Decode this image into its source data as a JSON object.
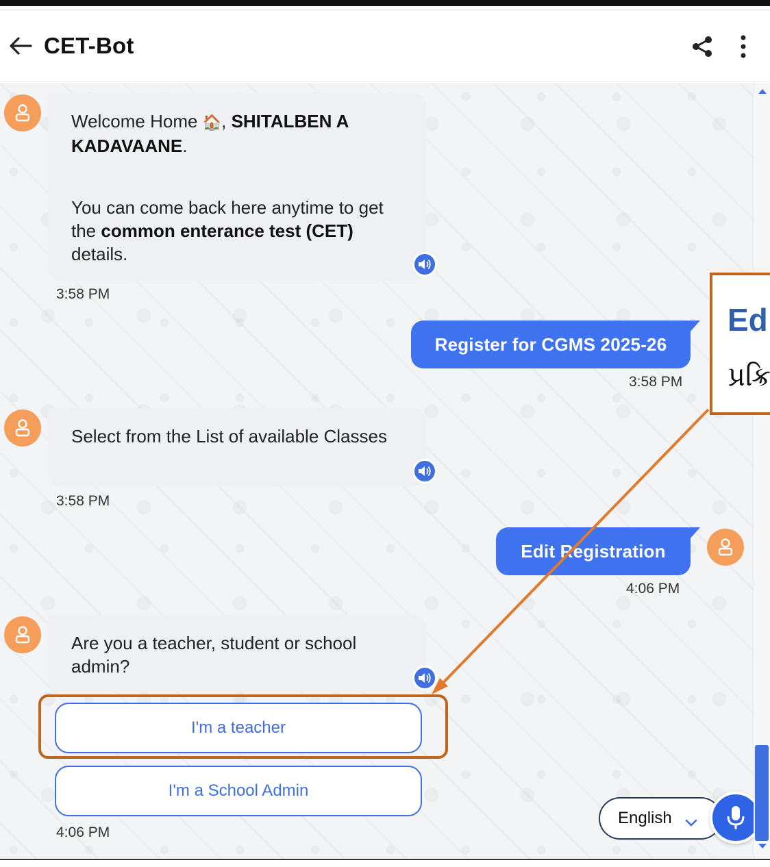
{
  "header": {
    "title": "CET-Bot"
  },
  "messages": {
    "welcome": {
      "line1_prefix": "Welcome Home",
      "emoji": "🏠",
      "comma": ", ",
      "name": "SHITALBEN A KADAVAANE",
      "period": ".",
      "line2_prefix": "You can come back here anytime to get the ",
      "line2_bold": "common enterance test (CET)",
      "line2_suffix": " details.",
      "time": "3:58 PM"
    },
    "user1": {
      "text": "Register for CGMS 2025-26",
      "time": "3:58 PM"
    },
    "select_class": {
      "text": "Select from the List of available Classes",
      "time": "3:58 PM"
    },
    "user2": {
      "text": "Edit Registration",
      "time": "4:06 PM"
    },
    "role_question": {
      "text": "Are you a teacher, student or school admin?",
      "time": "4:06 PM"
    }
  },
  "options": [
    {
      "label": "I'm a teacher"
    },
    {
      "label": "I'm a School Admin"
    }
  ],
  "language": {
    "selected": "English"
  },
  "annotation": {
    "title": "Ed",
    "subtitle": "પ્રક્રિ"
  },
  "colors": {
    "accent": "#3f72ef",
    "avatar": "#f59e5b",
    "annotation": "#c0651e",
    "bot_bubble": "#eef0f3"
  },
  "icons": [
    "back-arrow-icon",
    "share-icon",
    "more-vertical-icon",
    "user-avatar-icon",
    "speaker-icon",
    "chevron-down-icon",
    "microphone-icon"
  ]
}
